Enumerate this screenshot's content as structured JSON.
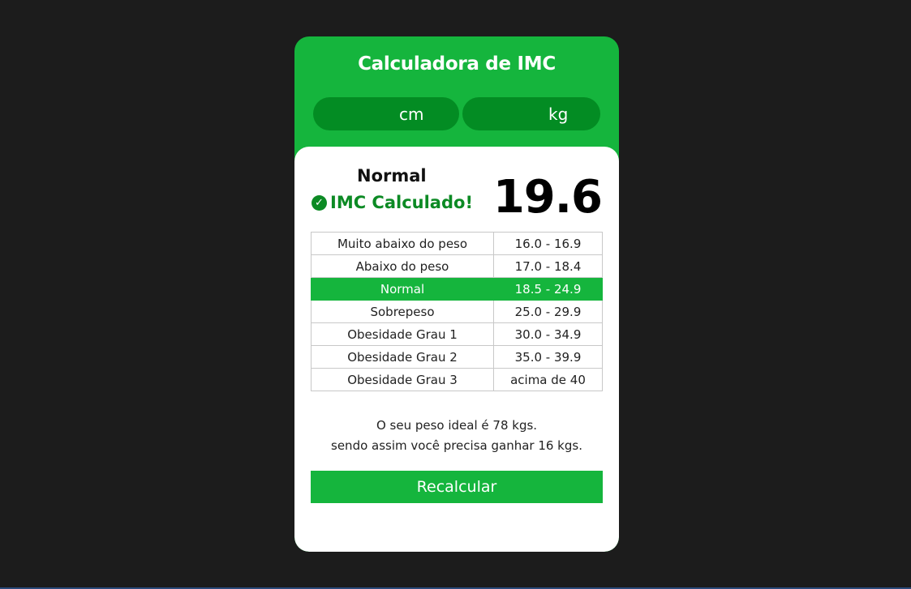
{
  "app": {
    "title": "Calculadora de IMC"
  },
  "inputs": {
    "height": {
      "value": "",
      "placeholder": "",
      "unit": "cm"
    },
    "weight": {
      "value": "",
      "placeholder": "",
      "unit": "kg"
    }
  },
  "result": {
    "category": "Normal",
    "message": "IMC Calculado!",
    "value": "19.6",
    "icon": "check-circle-icon"
  },
  "table": {
    "rows": [
      {
        "label": "Muito abaixo do peso",
        "range": "16.0 - 16.9",
        "active": false
      },
      {
        "label": "Abaixo do peso",
        "range": "17.0 - 18.4",
        "active": false
      },
      {
        "label": "Normal",
        "range": "18.5 - 24.9",
        "active": true
      },
      {
        "label": "Sobrepeso",
        "range": "25.0 - 29.9",
        "active": false
      },
      {
        "label": "Obesidade Grau 1",
        "range": "30.0 - 34.9",
        "active": false
      },
      {
        "label": "Obesidade Grau 2",
        "range": "35.0 - 39.9",
        "active": false
      },
      {
        "label": "Obesidade Grau 3",
        "range": "acima de 40",
        "active": false
      }
    ]
  },
  "ideal": {
    "line1": "O seu peso ideal é 78 kgs.",
    "line2": "sendo assim você precisa ganhar 16 kgs."
  },
  "actions": {
    "recalculate_label": "Recalcular"
  },
  "colors": {
    "background": "#1c1c1c",
    "accent": "#15b53d",
    "accent_dark": "#038c23",
    "success_text": "#0c8a24"
  }
}
